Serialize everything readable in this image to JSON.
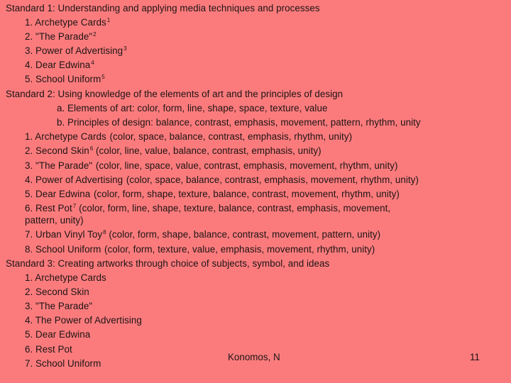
{
  "background_color": "#fb7b7d",
  "standard1": {
    "heading": "Standard 1: Understanding and applying  media techniques and processes",
    "items": [
      {
        "text": "1. Archetype Cards",
        "sup": "1"
      },
      {
        "text": "2. \"The Parade\"",
        "sup": "2"
      },
      {
        "text": "3. Power of Advertising",
        "sup": "3"
      },
      {
        "text": "4. Dear Edwina",
        "sup": "4"
      },
      {
        "text": "5. School Uniform",
        "sup": "5"
      }
    ]
  },
  "standard2": {
    "heading": "Standard 2: Using knowledge of the elements of art and the principles of design",
    "subpoints": [
      "a. Elements of art: color, form, line, shape, space, texture, value",
      "b. Principles of design: balance, contrast, emphasis, movement, pattern, rhythm, unity"
    ],
    "items": [
      {
        "text": "1. Archetype Cards",
        "sup": "",
        "rest": " (color, space, balance, contrast, emphasis, rhythm, unity)"
      },
      {
        "text": "2. Second Skin",
        "sup": "6",
        "rest": " (color, line, value, balance, contrast, emphasis, unity)"
      },
      {
        "text": "3. \"The Parade\"",
        "sup": "",
        "rest": " (color, line, space, value, contrast, emphasis, movement, rhythm, unity)"
      },
      {
        "text": "4. Power of Advertising",
        "sup": "",
        "rest": " (color, space, balance, contrast, emphasis, movement, rhythm, unity)"
      },
      {
        "text": "5. Dear Edwina",
        "sup": "",
        "rest": " (color, form, shape, texture, balance, contrast, movement, rhythm, unity)"
      },
      {
        "text": "6. Rest Pot",
        "sup": "7",
        "rest": " (color, form, line, shape, texture, balance, contrast, emphasis, movement,",
        "cont": "pattern, unity)"
      },
      {
        "text": "7. Urban Vinyl Toy",
        "sup": "8",
        "rest": " (color, form, shape, balance, contrast, movement, pattern, unity)"
      },
      {
        "text": "8. School Uniform",
        "sup": "",
        "rest": " (color, form, texture, value, emphasis, movement, rhythm, unity)"
      }
    ]
  },
  "standard3": {
    "heading": "Standard 3: Creating artworks through choice of subjects, symbol, and ideas",
    "items": [
      "1. Archetype Cards",
      "2. Second Skin",
      "3. \"The Parade\"",
      "4. The Power of Advertising",
      "5. Dear Edwina",
      "6. Rest Pot",
      "7. School Uniform"
    ]
  },
  "footer": {
    "author": "Konomos, N",
    "page_number": "11"
  }
}
